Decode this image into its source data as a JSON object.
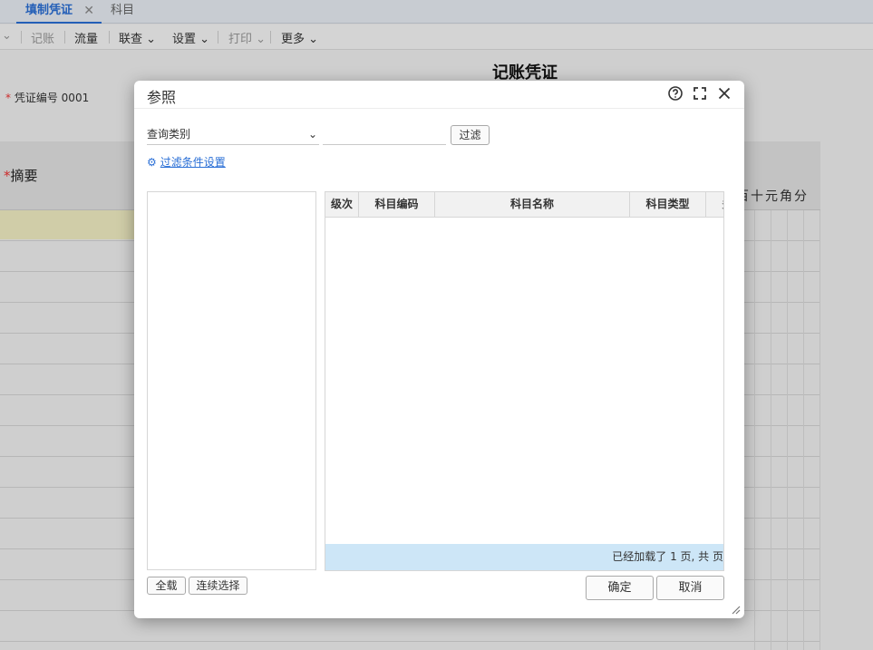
{
  "tabs": {
    "active": "填制凭证",
    "other": "科目"
  },
  "toolbar": [
    "记账",
    "流量",
    "联查",
    "设置",
    "打印",
    "更多"
  ],
  "voucher": {
    "title": "记账凭证",
    "number_label": "凭证编号",
    "number": "0001",
    "summary_col": "摘要",
    "digit_labels": "百十元角分"
  },
  "dialog": {
    "title": "参照",
    "query_select": "查询类别",
    "filter_input": "",
    "filter_button": "过滤",
    "filter_settings": "过滤条件设置",
    "columns": [
      "级次",
      "科目编码",
      "科目名称",
      "科目类型",
      "多"
    ],
    "status": "已经加载了 1 页, 共 页",
    "select_all_button": "全载",
    "continuous_select_button": "连续选择",
    "ok_button": "确定",
    "cancel_button": "取消"
  },
  "icons": {
    "help": "help-icon",
    "maximize": "maximize-icon",
    "close": "close-icon",
    "gear": "gear-icon"
  },
  "colors": {
    "accent": "#2a6fd6",
    "status_bar": "#cde6f7",
    "highlight_row": "#f3efc4"
  }
}
